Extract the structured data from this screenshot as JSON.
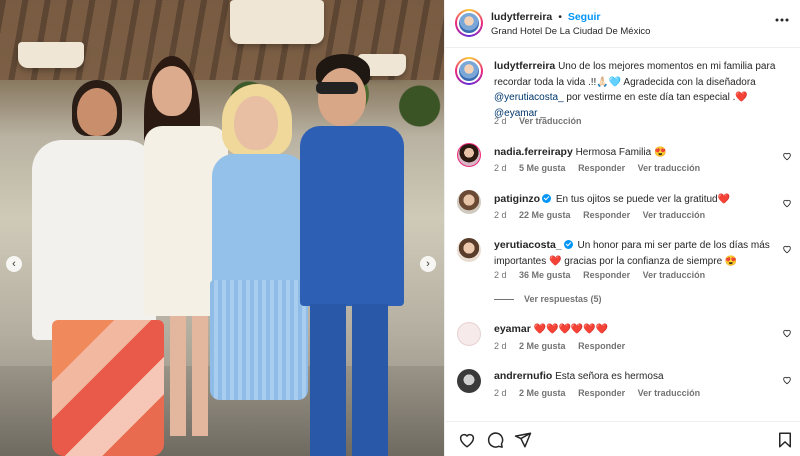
{
  "header": {
    "username": "ludytferreira",
    "separator": "•",
    "follow_label": "Seguir",
    "location": "Grand Hotel De La Ciudad De México",
    "more_icon": "more-options-icon"
  },
  "caption": {
    "username": "ludytferreira",
    "text_1": "Uno de los mejores momentos en mi familia para recordar toda la vida .!!",
    "emoji_1": "🙏🏻🩵",
    "text_2": "Agradecida con la diseñadora",
    "mention_1": "@yerutiacosta_",
    "text_3": "por vestirme en este día tan especial .",
    "emoji_2": "❤️",
    "mention_2": "@eyamar",
    "text_4": "_",
    "time": "2 d",
    "translate": "Ver traducción"
  },
  "comments": [
    {
      "username": "nadia.ferreirapy",
      "verified": false,
      "text": "Hermosa Familia",
      "emoji": "😍",
      "time": "2 d",
      "likes": "5 Me gusta",
      "reply": "Responder",
      "translate": "Ver traducción"
    },
    {
      "username": "patiginzo",
      "verified": true,
      "text": "En tus ojitos se puede ver la gratitud",
      "emoji": "❤️",
      "time": "2 d",
      "likes": "22 Me gusta",
      "reply": "Responder",
      "translate": "Ver traducción"
    },
    {
      "username": "yerutiacosta_",
      "verified": true,
      "text_1": "Un honor para mi ser parte de los días más importantes",
      "emoji_1": "❤️",
      "text_2": "gracias por la confianza de siempre",
      "emoji_2": "😍",
      "time": "2 d",
      "likes": "36 Me gusta",
      "reply": "Responder",
      "translate": "Ver traducción",
      "view_replies": "Ver respuestas (5)"
    },
    {
      "username": "eyamar",
      "verified": false,
      "text": "❤️❤️❤️❤️❤️❤️",
      "time": "2 d",
      "likes": "2 Me gusta",
      "reply": "Responder"
    },
    {
      "username": "andrernufio",
      "verified": false,
      "text": "Esta señora es hermosa",
      "time": "2 d",
      "likes": "2 Me gusta",
      "reply": "Responder",
      "translate": "Ver traducción"
    }
  ],
  "actions": {
    "like": "heart-icon",
    "comment": "comment-icon",
    "share": "share-icon",
    "save": "bookmark-icon"
  },
  "carousel": {
    "prev": "‹",
    "next": "›"
  },
  "colors": {
    "accent": "#0095f6",
    "text": "#262626",
    "muted": "#737373",
    "link": "#00376b",
    "heart": "#ed1c24"
  }
}
